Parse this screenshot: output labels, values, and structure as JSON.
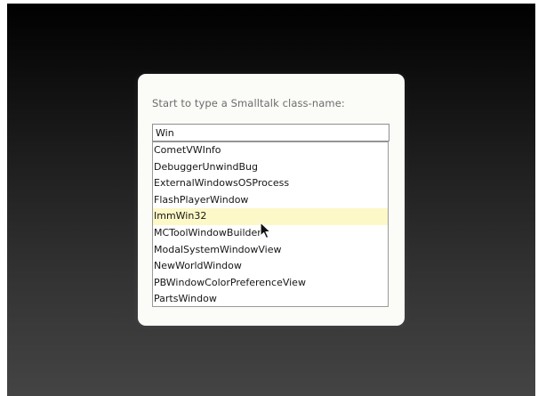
{
  "dialog": {
    "prompt": "Start to type a Smalltalk class-name:",
    "search": {
      "value": "Win"
    },
    "results": [
      {
        "label": "CometVWInfo",
        "selected": false
      },
      {
        "label": "DebuggerUnwindBug",
        "selected": false
      },
      {
        "label": "ExternalWindowsOSProcess",
        "selected": false
      },
      {
        "label": "FlashPlayerWindow",
        "selected": false
      },
      {
        "label": "ImmWin32",
        "selected": true
      },
      {
        "label": "MCToolWindowBuilder",
        "selected": false
      },
      {
        "label": "ModalSystemWindowView",
        "selected": false
      },
      {
        "label": "NewWorldWindow",
        "selected": false
      },
      {
        "label": "PBWindowColorPreferenceView",
        "selected": false
      },
      {
        "label": "PartsWindow",
        "selected": false
      }
    ],
    "highlight_color": "#fdf8c8"
  },
  "cursor_icon": "arrow-pointer-icon"
}
